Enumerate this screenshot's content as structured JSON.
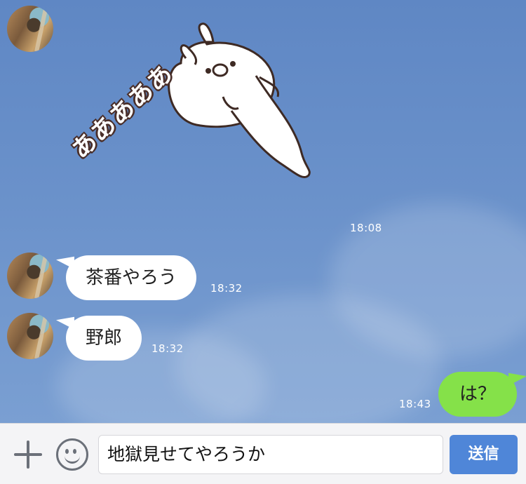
{
  "messages": [
    {
      "sender": "them",
      "type": "sticker",
      "sticker_text": "あああああ",
      "time": "18:08"
    },
    {
      "sender": "them",
      "type": "text",
      "text": "茶番やろう",
      "time": "18:32"
    },
    {
      "sender": "them",
      "type": "text",
      "text": "野郎",
      "time": "18:32"
    },
    {
      "sender": "me",
      "type": "text",
      "text": "は？",
      "time": "18:43"
    }
  ],
  "composer": {
    "input_value": "地獄見せてやろうか",
    "send_label": "送信",
    "plus_icon": "plus-icon",
    "emoji_icon": "emoji-icon"
  },
  "colors": {
    "chat_background": "#6a91ca",
    "outgoing_bubble": "#85e149",
    "incoming_bubble": "#ffffff",
    "send_button": "#4f86d8"
  }
}
